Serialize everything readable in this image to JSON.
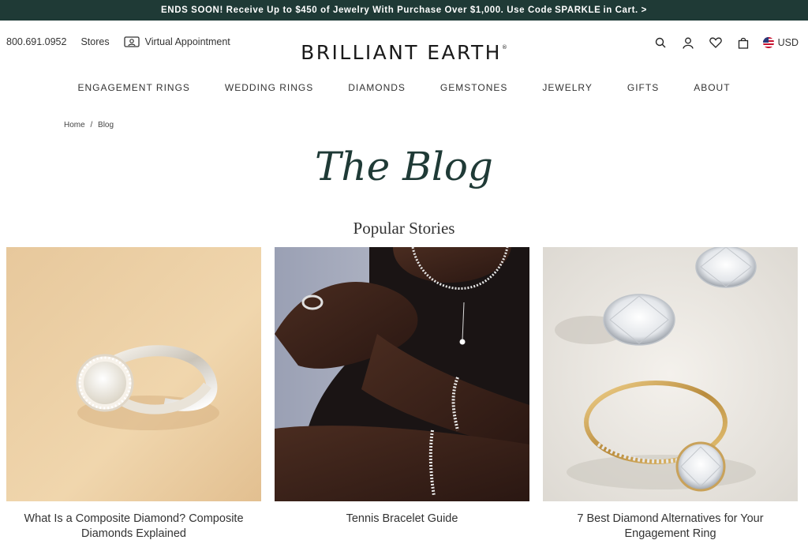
{
  "promo": {
    "text_before": "ENDS SOON! Receive Up to $450 of Jewelry With Purchase Over $1,000. Use Code",
    "code": "SPARKLE",
    "text_after": "in Cart. >"
  },
  "utility": {
    "phone": "800.691.0952",
    "stores": "Stores",
    "virtual_appointment": "Virtual Appointment",
    "currency": "USD"
  },
  "brand": {
    "logo_text": "BRILLIANT EARTH",
    "trademark": "®"
  },
  "nav": {
    "items": [
      {
        "label": "ENGAGEMENT RINGS"
      },
      {
        "label": "WEDDING RINGS"
      },
      {
        "label": "DIAMONDS"
      },
      {
        "label": "GEMSTONES"
      },
      {
        "label": "JEWELRY"
      },
      {
        "label": "GIFTS"
      },
      {
        "label": "ABOUT"
      }
    ]
  },
  "breadcrumb": {
    "home": "Home",
    "separator": "/",
    "current": "Blog"
  },
  "page": {
    "title": "The Blog",
    "section_title": "Popular Stories"
  },
  "stories": [
    {
      "caption": "What Is a Composite Diamond? Composite Diamonds Explained"
    },
    {
      "caption": "Tennis Bracelet Guide"
    },
    {
      "caption": "7 Best Diamond Alternatives for Your Engagement Ring"
    }
  ],
  "colors": {
    "brand_dark_green": "#1f3a36",
    "text": "#333333"
  }
}
